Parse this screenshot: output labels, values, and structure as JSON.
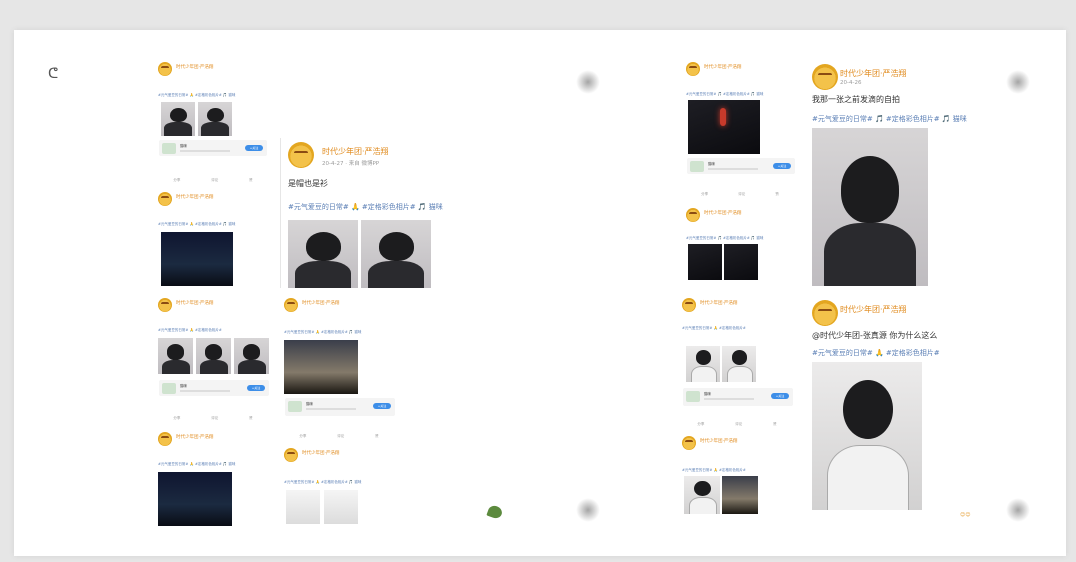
{
  "account_name": "时代少年团·严浩翔",
  "big_post_1": {
    "date": "20-4-27 · 来自 微博PP",
    "text": "是帽也是衫",
    "tags": "#元气爱豆的日常# 🙏 #定格彩色相片# 🎵 猫咪"
  },
  "big_post_2": {
    "date": "20-4-26",
    "text": "我那一张之前发滴的自拍",
    "tags": "#元气爱豆的日常# 🎵 #定格彩色相片# 🎵 猫咪"
  },
  "big_post_3": {
    "text": "@时代少年团-张真源 你为什么这么",
    "tags": "#元气爱豆的日常# 🙏 #定格彩色相片#"
  },
  "small_labels": {
    "card_title": "猫咪",
    "card_title_2": "猫咪",
    "card_title_3": "猫咪",
    "card_title_4": "猫咪",
    "card_title_5": "猫咪",
    "card_btn": "+关注",
    "share": "分享",
    "comment": "评论",
    "like": "赞"
  },
  "colors": {
    "accent": "#e08a1c",
    "link": "#5b7fb5",
    "button": "#3d8ee8"
  }
}
